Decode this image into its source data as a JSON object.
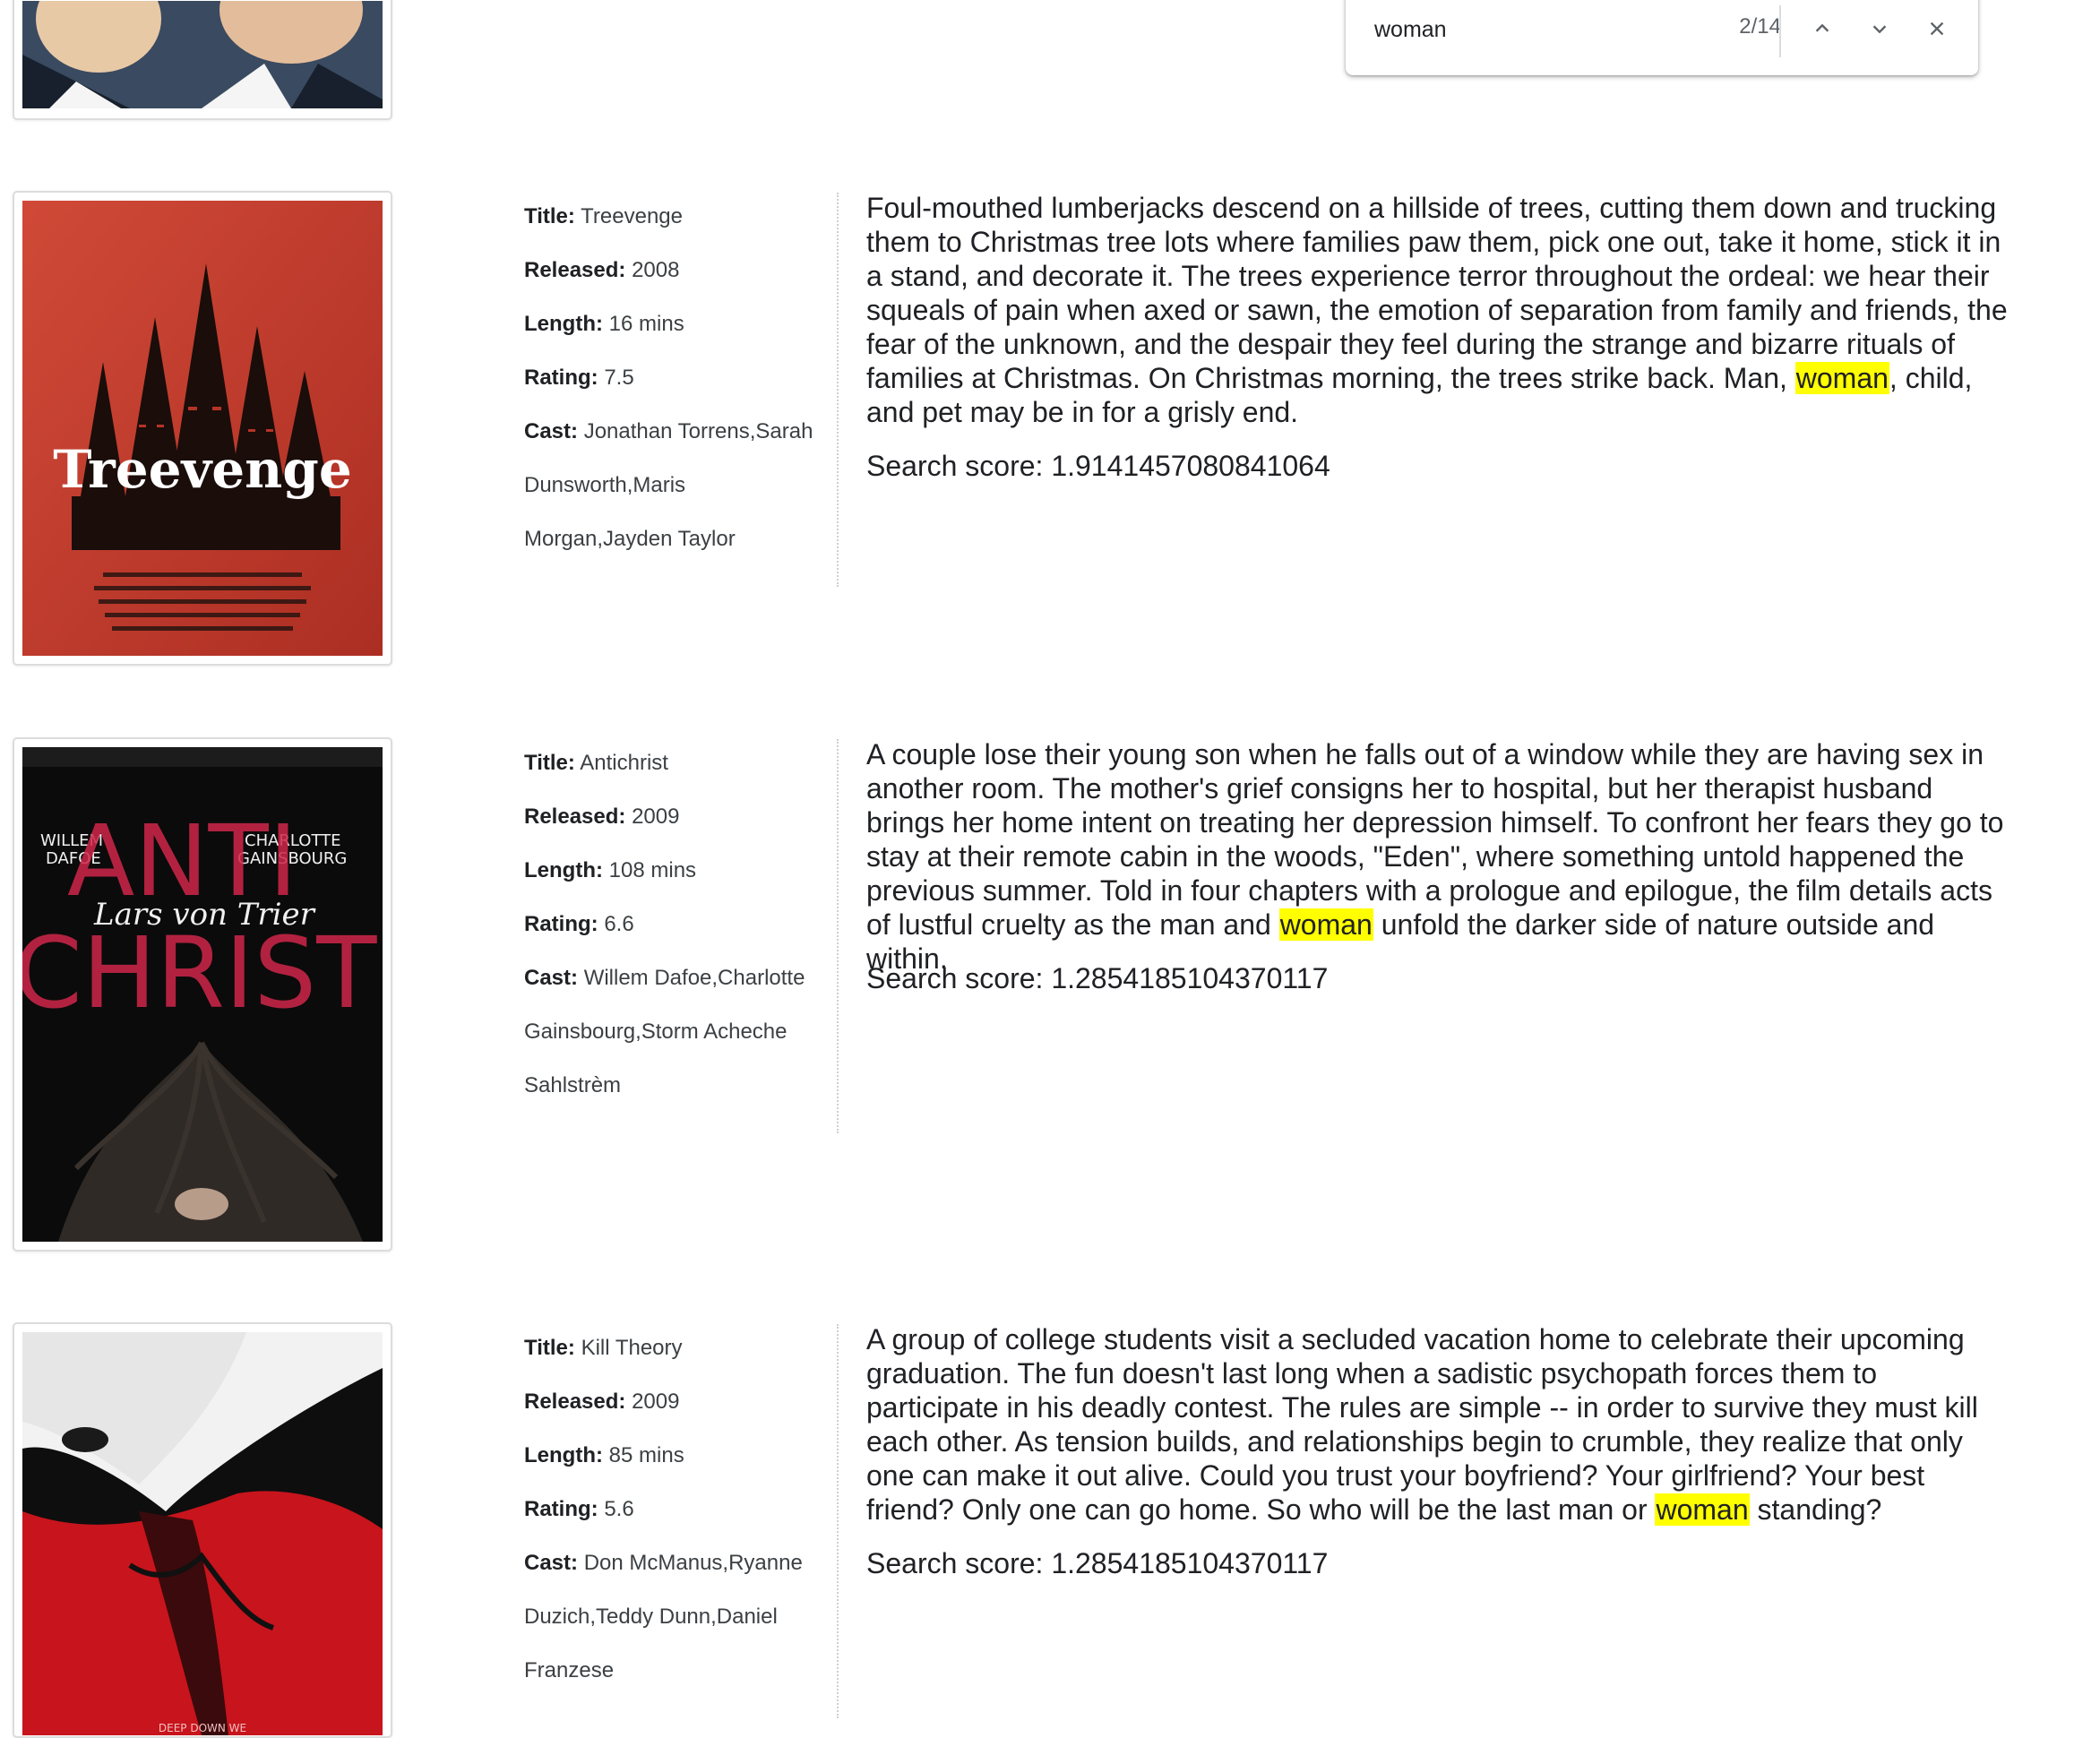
{
  "find_bar": {
    "query": "woman",
    "match_count": "2/14"
  },
  "movies": [
    {
      "title_label": "Title:",
      "title": "Treevenge",
      "released_label": "Released:",
      "released": "2008",
      "length_label": "Length:",
      "length": "16 mins",
      "rating_label": "Rating:",
      "rating": "7.5",
      "cast_label": "Cast:",
      "cast": "Jonathan Torrens,Sarah Dunsworth,Maris Morgan,Jayden Taylor",
      "description_before": "Foul-mouthed lumberjacks descend on a hillside of trees, cutting them down and trucking them to Christmas tree lots where families paw them, pick one out, take it home, stick it in a stand, and decorate it. The trees experience terror throughout the ordeal: we hear their squeals of pain when axed or sawn, the emotion of separation from family and friends, the fear of the unknown, and the despair they feel during the strange and bizarre rituals of families at Christmas. On Christmas morning, the trees strike back. Man, ",
      "highlight": "woman",
      "description_after": ", child, and pet may be in for a grisly end.",
      "score": "Search score: 1.9141457080841064",
      "poster_text": "Treevenge",
      "poster_colors": {
        "bg": "#c7382b",
        "trees": "#1a0d0a",
        "text": "#ffffff"
      }
    },
    {
      "title_label": "Title:",
      "title": "Antichrist",
      "released_label": "Released:",
      "released": "2009",
      "length_label": "Length:",
      "length": "108 mins",
      "rating_label": "Rating:",
      "rating": "6.6",
      "cast_label": "Cast:",
      "cast": "Willem Dafoe,Charlotte Gainsbourg,Storm Acheche Sahlstrèm",
      "description_before": "A couple lose their young son when he falls out of a window while they are having sex in another room. The mother's grief consigns her to hospital, but her therapist husband brings her home intent on treating her depression himself. To confront her fears they go to stay at their remote cabin in the woods, \"Eden\", where something untold happened the previous summer. Told in four chapters with a prologue and epilogue, the film details acts of lustful cruelty as the man and ",
      "highlight": "woman",
      "description_after": " unfold the darker side of nature outside and within.",
      "score": "Search score: 1.2854185104370117",
      "poster_text_1": "WILLEM",
      "poster_text_2": "DAFOE",
      "poster_text_3": "CHARLOTTE",
      "poster_text_4": "GAINSBOURG",
      "poster_text_5": "Lars von Trier",
      "poster_text_6": "ANTI",
      "poster_text_7": "CHRIST",
      "poster_colors": {
        "bg": "#0b0b0b",
        "title": "#d0274a",
        "text": "#f0f0f0"
      }
    },
    {
      "title_label": "Title:",
      "title": "Kill Theory",
      "released_label": "Released:",
      "released": "2009",
      "length_label": "Length:",
      "length": "85 mins",
      "rating_label": "Rating:",
      "rating": "5.6",
      "cast_label": "Cast:",
      "cast": "Don McManus,Ryanne Duzich,Teddy Dunn,Daniel Franzese",
      "description_before": "A group of college students visit a secluded vacation home to celebrate their upcoming graduation. The fun doesn't last long when a sadistic psychopath forces them to participate in his deadly contest. The rules are simple -- in order to survive they must kill each other. As tension builds, and relationships begin to crumble, they realize that only one can make it out alive. Could you trust your boyfriend? Your girlfriend? Your best friend? Only one can go home. So who will be the last man or ",
      "highlight": "woman",
      "description_after": " standing?",
      "score": "Search score: 1.2854185104370117",
      "poster_text": "DEEP DOWN WE",
      "poster_colors": {
        "bg": "#f2f2f2",
        "red": "#c8141c",
        "dark": "#111111"
      }
    }
  ],
  "colors": {
    "highlight": "#ffff00",
    "divider": "#cfcfcf"
  }
}
